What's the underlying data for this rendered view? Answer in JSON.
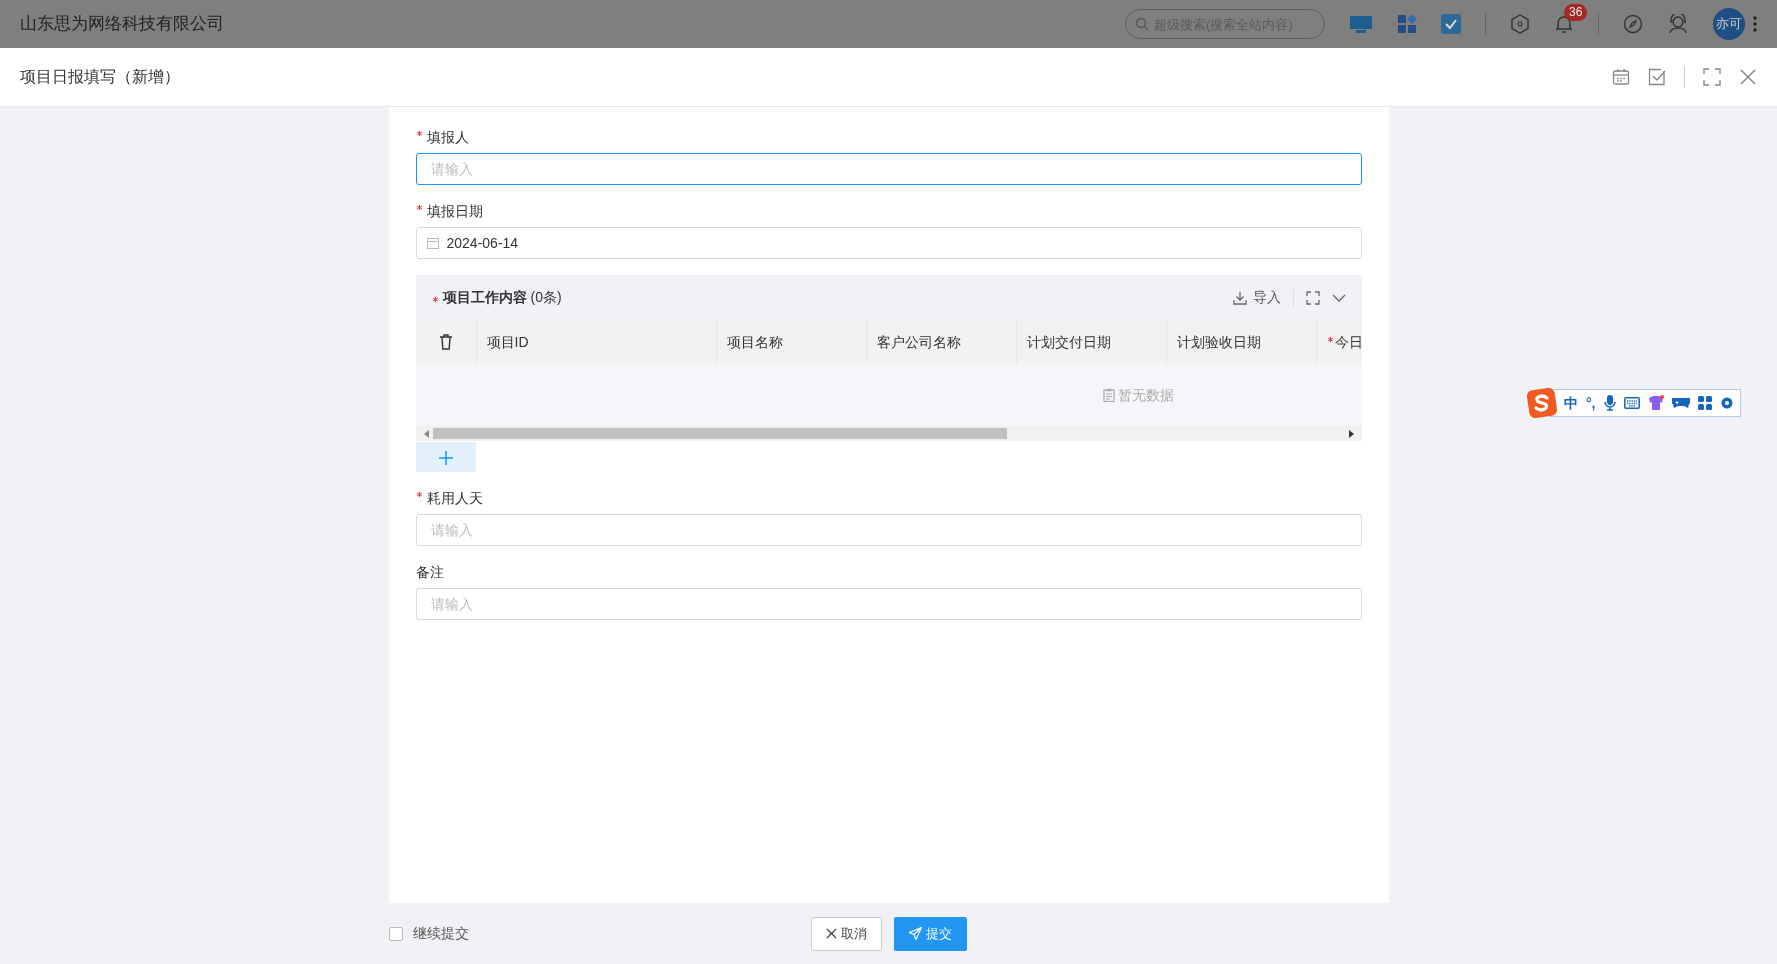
{
  "top_bar": {
    "company": "山东思为网络科技有限公司",
    "search": {
      "placeholder": "超级搜索(搜索全站内容)"
    },
    "notification_count": "36",
    "avatar": "亦可"
  },
  "dialog": {
    "title": "项目日报填写（新增）"
  },
  "fields": [
    {
      "kind": "text",
      "label": "填报人",
      "required": true,
      "placeholder": "请输入",
      "focused": true
    },
    {
      "kind": "date",
      "label": "填报日期",
      "required": true,
      "value": "2024-06-14",
      "focused": false
    },
    {
      "kind": "table",
      "title": "项目工作内容",
      "count": "(0条)",
      "required": true,
      "import_label": "导入",
      "columns": [
        {
          "label": "项目ID",
          "required": false
        },
        {
          "label": "项目名称",
          "required": false
        },
        {
          "label": "客户公司名称",
          "required": false
        },
        {
          "label": "计划交付日期",
          "required": false
        },
        {
          "label": "计划验收日期",
          "required": false
        },
        {
          "label": "今日",
          "required": true
        }
      ],
      "empty_text": "暂无数据"
    },
    {
      "kind": "text",
      "label": "耗用人天",
      "required": true,
      "placeholder": "请输入",
      "focused": false
    },
    {
      "kind": "text",
      "label": "备注",
      "required": false,
      "placeholder": "请输入",
      "focused": false
    }
  ],
  "footer": {
    "continue_checkbox": {
      "label": "继续提交",
      "checked": false
    },
    "buttons": [
      {
        "kind": "cancel",
        "label": "取消"
      },
      {
        "kind": "submit",
        "label": "提交"
      }
    ]
  },
  "ime_toolbar": {
    "mode": "中",
    "punctuation": "°,"
  }
}
